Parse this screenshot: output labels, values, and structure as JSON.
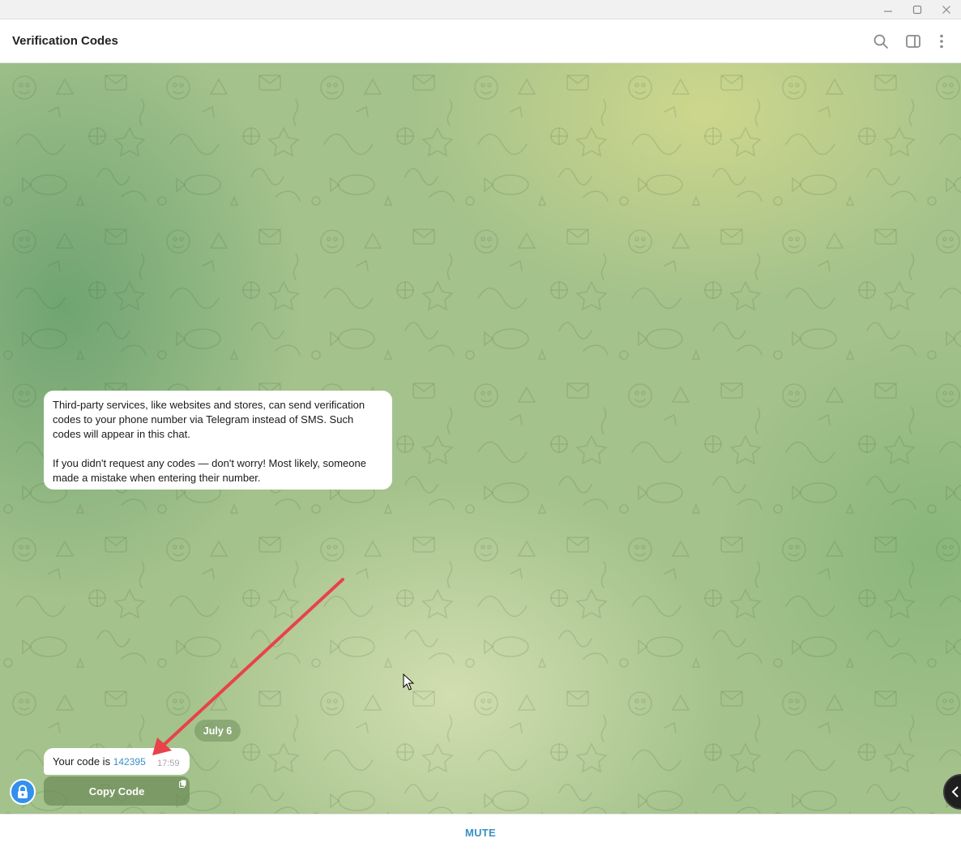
{
  "window": {
    "controls": [
      "minimize",
      "maximize",
      "close"
    ]
  },
  "header": {
    "title": "Verification Codes",
    "icons": [
      "search-icon",
      "side-panel-icon",
      "more-icon"
    ]
  },
  "messages": {
    "info_paragraph_1": "Third-party services, like websites and stores, can send verification codes to your phone number via Telegram instead of SMS. Such codes will appear in this chat.",
    "info_paragraph_2": "If you didn't request any codes — don't worry! Most likely, someone made a mistake when entering their number.",
    "date_separator": "July 6",
    "code_prefix": "Your code is",
    "code_value": "142395",
    "code_time": "17:59",
    "copy_button_label": "Copy Code"
  },
  "footer": {
    "mute_label": "MUTE"
  },
  "colors": {
    "accent": "#3a8fc4",
    "avatar": "#3390ec",
    "annotation_arrow": "#e8424a"
  }
}
